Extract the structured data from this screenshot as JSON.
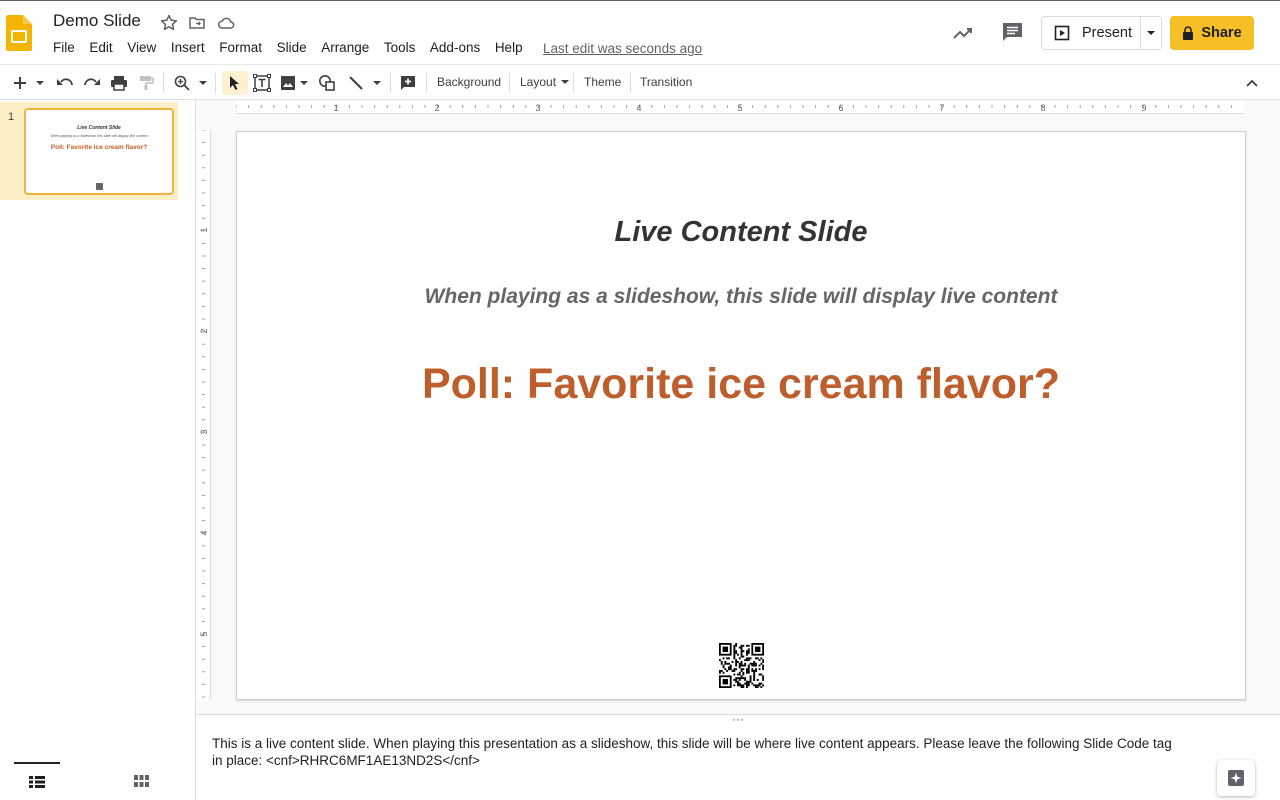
{
  "header": {
    "doc_title": "Demo Slide",
    "menu": [
      "File",
      "Edit",
      "View",
      "Insert",
      "Format",
      "Slide",
      "Arrange",
      "Tools",
      "Add-ons",
      "Help"
    ],
    "last_edit": "Last edit was seconds ago",
    "present_label": "Present",
    "share_label": "Share",
    "share_color": "#f6bf26"
  },
  "toolbar": {
    "background_label": "Background",
    "layout_label": "Layout",
    "theme_label": "Theme",
    "transition_label": "Transition",
    "icons": [
      "new-slide-icon",
      "undo-icon",
      "redo-icon",
      "print-icon",
      "paint-format-icon",
      "zoom-icon",
      "select-icon",
      "text-box-icon",
      "image-icon",
      "shape-icon",
      "line-icon",
      "add-comment-icon",
      "collapse-icon"
    ]
  },
  "filmstrip": {
    "slides": [
      {
        "number": "1",
        "title": "Live Content Slide",
        "subtitle": "When playing as a slideshow, this slide will display live content",
        "poll": "Poll: Favorite ice cream flavor?"
      }
    ]
  },
  "rulers": {
    "horizontal_marks": [
      "1",
      "2",
      "3",
      "4",
      "5",
      "6",
      "7",
      "8",
      "9"
    ],
    "vertical_marks": [
      "1",
      "2",
      "3",
      "4",
      "5"
    ]
  },
  "slide": {
    "title": "Live Content Slide",
    "subtitle": "When playing as a slideshow, this slide will display live content",
    "poll": "Poll: Favorite ice cream flavor?",
    "title_color": "#333333",
    "subtitle_color": "#666666",
    "poll_color": "#bd5e2c"
  },
  "notes": {
    "text": "This is a live content slide. When playing this presentation as a slideshow, this slide will be where live content appears. Please leave the following Slide Code tag in place: <cnf>RHRC6MF1AE13ND2S</cnf>"
  }
}
